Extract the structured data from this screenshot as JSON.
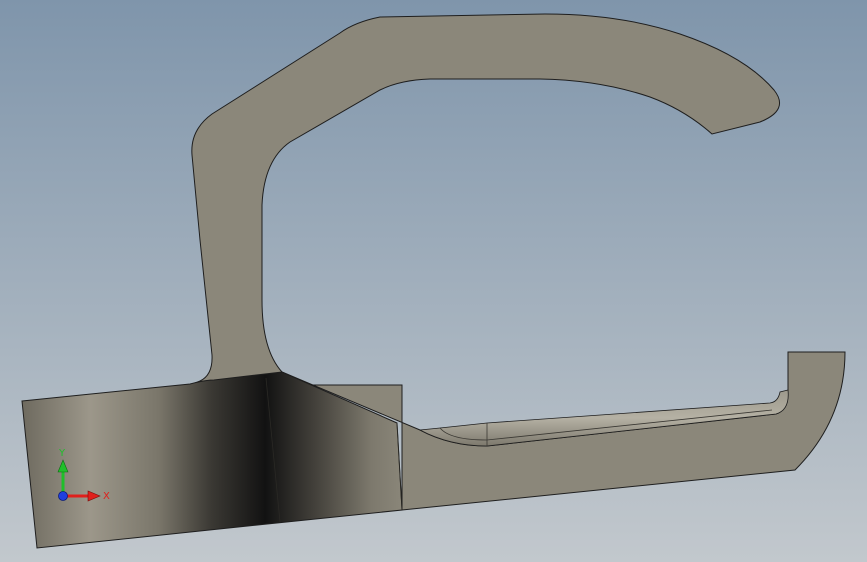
{
  "viewport": {
    "background_top": "#7f95ab",
    "background_bottom": "#c2c8cd",
    "part_face_color": "#8b877a",
    "part_edge_color": "#1e1e1e",
    "part_highlight_color": "#a39e90",
    "part_shadow_color": "#141414"
  },
  "triad": {
    "x_label": "X",
    "y_label": "Y",
    "x_color": "#e0201c",
    "y_color": "#1fbf2a",
    "z_color": "#1f3fe0",
    "icon": "axis-triad-icon"
  }
}
